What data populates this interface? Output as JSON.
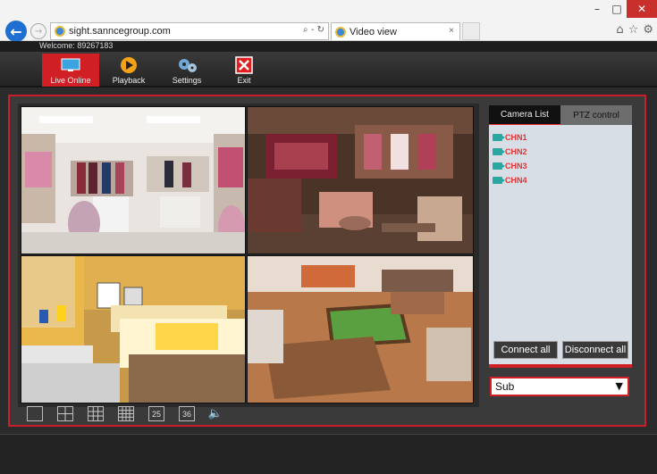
{
  "browser": {
    "url": "sight.sanncegroup.com",
    "address_tools": "⌕ ‑ ↻",
    "tab_title": "Video view",
    "tab_close": "×",
    "win_minimize": "–",
    "win_restore": "□",
    "win_close": "✕",
    "icons": [
      "home-icon",
      "star-icon",
      "gear-icon"
    ]
  },
  "app": {
    "welcome": "Welcome: 89267183",
    "toolbar": [
      {
        "label": "Live Online",
        "icon": "monitor-icon",
        "active": true
      },
      {
        "label": "Playback",
        "icon": "play-icon",
        "active": false
      },
      {
        "label": "Settings",
        "icon": "gears-icon",
        "active": false
      },
      {
        "label": "Exit",
        "icon": "exit-icon",
        "active": false
      }
    ],
    "accent_color": "#d11f26"
  },
  "side_panel": {
    "tabs": [
      "Camera List",
      "PTZ control"
    ],
    "channels": [
      "CHN1",
      "CHN2",
      "CHN3",
      "CHN4"
    ],
    "connect_all": "Connect all",
    "disconnect_all": "Disconnect all",
    "stream_select": "Sub"
  },
  "grid_buttons": [
    "1",
    "4",
    "9",
    "16",
    "25",
    "36",
    "audio"
  ],
  "grid_labels": {
    "b25": "25",
    "b36": "36"
  }
}
